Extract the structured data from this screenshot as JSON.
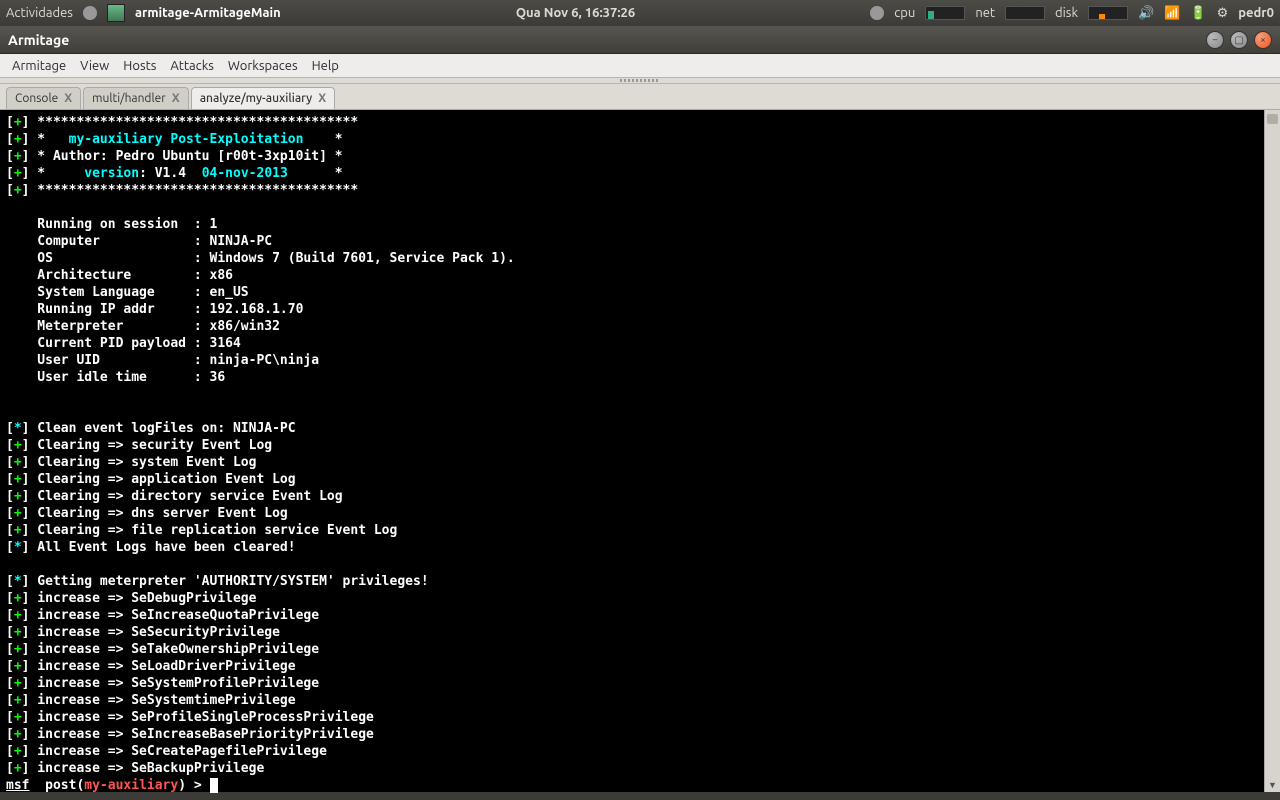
{
  "panel": {
    "activities": "Actividades",
    "window_task": "armitage-ArmitageMain",
    "clock": "Qua Nov  6, 16:37:26",
    "cpu_label": "cpu",
    "net_label": "net",
    "disk_label": "disk",
    "user": "pedr0"
  },
  "window": {
    "title": "Armitage"
  },
  "menu": [
    "Armitage",
    "View",
    "Hosts",
    "Attacks",
    "Workspaces",
    "Help"
  ],
  "tabs": [
    {
      "label": "Console",
      "active": false
    },
    {
      "label": "multi/handler",
      "active": false
    },
    {
      "label": "analyze/my-auxiliary",
      "active": true
    }
  ],
  "console": {
    "banner": {
      "stars": "*****************************************",
      "l1_pre": "*   ",
      "l1_txt": "my-auxiliary Post-Exploitation",
      "l1_post": "    *",
      "l2": "* Author: Pedro Ubuntu [r00t-3xp10it] *",
      "l3_pre": "*     ",
      "l3_ver": "version",
      "l3_mid": ": V1.4  ",
      "l3_date": "04-nov-2013",
      "l3_post": "      *"
    },
    "info": [
      [
        "Running on session  ",
        "1"
      ],
      [
        "Computer            ",
        "NINJA-PC"
      ],
      [
        "OS                  ",
        "Windows 7 (Build 7601, Service Pack 1)."
      ],
      [
        "Architecture        ",
        "x86"
      ],
      [
        "System Language     ",
        "en_US"
      ],
      [
        "Running IP addr     ",
        "192.168.1.70"
      ],
      [
        "Meterpreter         ",
        "x86/win32"
      ],
      [
        "Current PID payload ",
        "3164"
      ],
      [
        "User UID            ",
        "ninja-PC\\ninja"
      ],
      [
        "User idle time      ",
        "36"
      ]
    ],
    "clean_header": "Clean event logFiles on: NINJA-PC",
    "clearing": [
      "Clearing => security Event Log",
      "Clearing => system Event Log",
      "Clearing => application Event Log",
      "Clearing => directory service Event Log",
      "Clearing => dns server Event Log",
      "Clearing => file replication service Event Log"
    ],
    "cleared_all": "All Event Logs have been cleared!",
    "priv_header": "Getting meterpreter 'AUTHORITY/SYSTEM' privileges!",
    "increase": [
      "increase => SeDebugPrivilege",
      "increase => SeIncreaseQuotaPrivilege",
      "increase => SeSecurityPrivilege",
      "increase => SeTakeOwnershipPrivilege",
      "increase => SeLoadDriverPrivilege",
      "increase => SeSystemProfilePrivilege",
      "increase => SeSystemtimePrivilege",
      "increase => SeProfileSingleProcessPrivilege",
      "increase => SeIncreaseBasePriorityPrivilege",
      "increase => SeCreatePagefilePrivilege",
      "increase => SeBackupPrivilege"
    ],
    "prompt": {
      "msf": "msf",
      "post": "  post(",
      "mod": "my-auxiliary",
      "end": ") > "
    }
  }
}
